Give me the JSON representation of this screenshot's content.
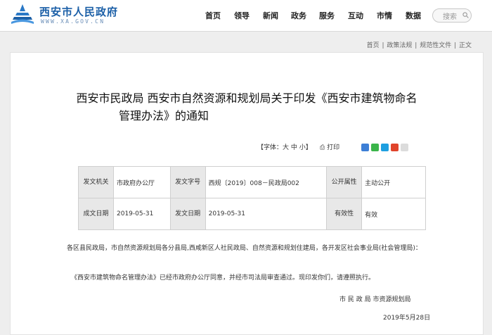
{
  "header": {
    "site_name": "西安市人民政府",
    "site_url": "WWW.XA.GOV.CN",
    "nav": [
      "首页",
      "领导",
      "新闻",
      "政务",
      "服务",
      "互动",
      "市情",
      "数据"
    ],
    "search_placeholder": "搜索"
  },
  "breadcrumb": [
    "首页",
    "政策法规",
    "规范性文件",
    "正文"
  ],
  "article": {
    "title_line1": "西安市民政局 西安市自然资源和规划局关于印发《西安市建筑物命名",
    "title_line2": "管理办法》的通知",
    "font_tool": "【字体：大 中 小】",
    "print_label": "打印",
    "info": {
      "issuer_label": "发文机关",
      "issuer": "市政府办公厅",
      "doc_no_label": "发文字号",
      "doc_no": "西规〔2019〕008－民政局002",
      "public_label": "公开属性",
      "public": "主动公开",
      "date_label": "成文日期",
      "date": "2019-05-31",
      "issue_date_label": "发文日期",
      "issue_date": "2019-05-31",
      "validity_label": "有效性",
      "validity": "有效"
    },
    "para1": "各区县民政局，市自然资源规划局各分县局,西咸新区人社民政局、自然资源和规划住建局，各开发区社会事业局(社会管理局)：",
    "para2": "《西安市建筑物命名管理办法》已经市政府办公厅同意，并经市司法局审查通过。现印发你们，请遵照执行。",
    "signature": "市 民 政 局   市资源规划局",
    "sign_date": "2019年5月28日"
  },
  "colors": {
    "brand": "#1b5fa7",
    "background": "#eeeeee",
    "table_label_bg": "#e8e8e8"
  }
}
